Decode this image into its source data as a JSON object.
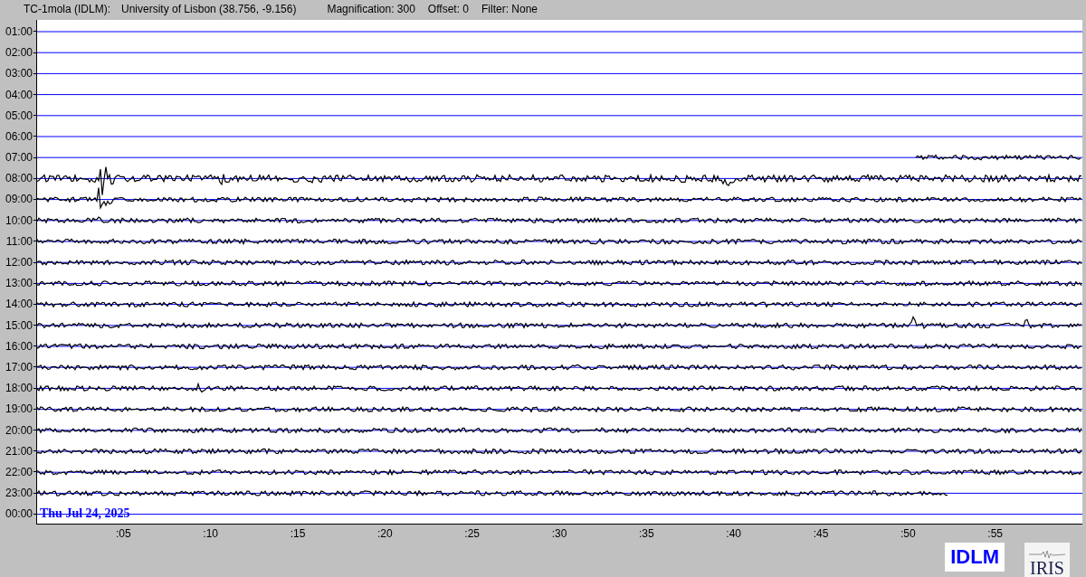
{
  "header": {
    "station": "TC-1mola (IDLM):",
    "location": "University of Lisbon (38.756, -9.156)",
    "magnification": "Magnification: 300",
    "offset": "Offset: 0",
    "filter": "Filter: None"
  },
  "rows": [
    {
      "label": "01:00",
      "kind": "blank"
    },
    {
      "label": "02:00",
      "kind": "blank"
    },
    {
      "label": "03:00",
      "kind": "blank"
    },
    {
      "label": "04:00",
      "kind": "blank"
    },
    {
      "label": "05:00",
      "kind": "blank"
    },
    {
      "label": "06:00",
      "kind": "blank"
    },
    {
      "label": "07:00",
      "kind": "late_start"
    },
    {
      "label": "08:00",
      "kind": "trace"
    },
    {
      "label": "09:00",
      "kind": "trace"
    },
    {
      "label": "10:00",
      "kind": "trace"
    },
    {
      "label": "11:00",
      "kind": "trace"
    },
    {
      "label": "12:00",
      "kind": "trace"
    },
    {
      "label": "13:00",
      "kind": "trace"
    },
    {
      "label": "14:00",
      "kind": "trace"
    },
    {
      "label": "15:00",
      "kind": "trace"
    },
    {
      "label": "16:00",
      "kind": "trace"
    },
    {
      "label": "17:00",
      "kind": "trace"
    },
    {
      "label": "18:00",
      "kind": "trace"
    },
    {
      "label": "19:00",
      "kind": "trace"
    },
    {
      "label": "20:00",
      "kind": "trace"
    },
    {
      "label": "21:00",
      "kind": "trace"
    },
    {
      "label": "22:00",
      "kind": "trace"
    },
    {
      "label": "23:00",
      "kind": "early_end"
    },
    {
      "label": "00:00",
      "kind": "blank"
    }
  ],
  "date": "Thu Jul 24, 2025",
  "xticks": [
    ":05",
    ":10",
    ":15",
    ":20",
    ":25",
    ":30",
    ":35",
    ":40",
    ":45",
    ":50",
    ":55"
  ],
  "logos": [
    {
      "kind": "idlm",
      "text": "IDLM"
    },
    {
      "kind": "iris",
      "text": "IRIS"
    }
  ]
}
